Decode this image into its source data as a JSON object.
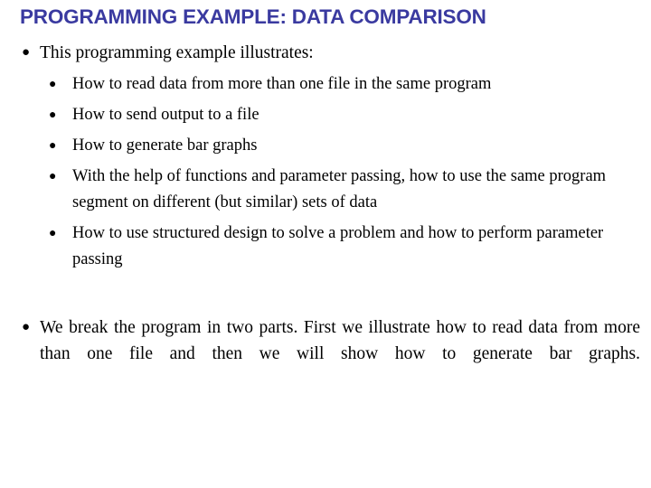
{
  "slide": {
    "title": "PROGRAMMING EXAMPLE: DATA COMPARISON",
    "title_color": "#3a3aa0",
    "background_color": "#ffffff",
    "text_color": "#000000",
    "bullet_glyph": "●",
    "intro": {
      "text": "This programming example illustrates:"
    },
    "sub_points": [
      {
        "text": "How to read data from more than one file in the same program"
      },
      {
        "text": "How to send output to a file"
      },
      {
        "text": "How to generate bar graphs"
      },
      {
        "text": "With the help of functions and parameter passing, how to use the same program segment on different (but similar) sets of data"
      },
      {
        "text": "How to use structured design to solve a problem and how to perform parameter passing"
      }
    ],
    "closing": {
      "text": "We break the program in two parts. First we illustrate how to read data from more than one file and then we will show how to generate bar graphs."
    }
  }
}
